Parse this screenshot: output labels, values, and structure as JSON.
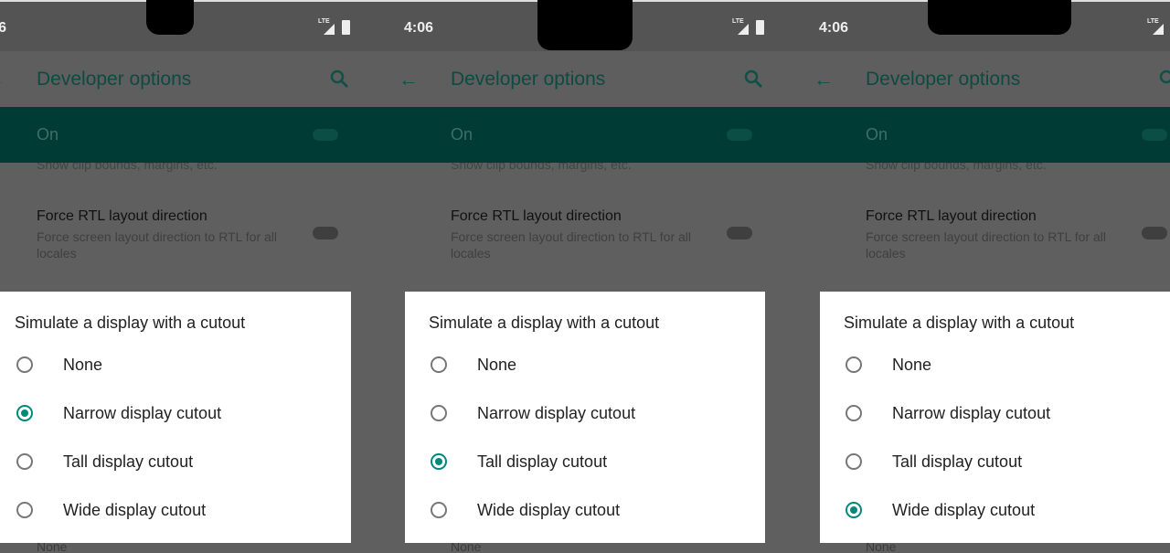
{
  "status_time": "4:06",
  "network_label": "LTE",
  "app_title": "Developer options",
  "master_switch_label": "On",
  "clip_bounds_subtitle": "Show clip bounds, margins, etc.",
  "rtl_title": "Force RTL layout direction",
  "rtl_subtitle": "Force screen layout direction to RTL for all locales",
  "below_dialog_value": "None",
  "dialog_title": "Simulate a display with a cutout",
  "options": [
    "None",
    "Narrow display cutout",
    "Tall display cutout",
    "Wide display cutout"
  ],
  "accent_color": "#00897b",
  "panels": [
    {
      "selected_option": "Narrow display cutout",
      "notch": "narrow"
    },
    {
      "selected_option": "Tall display cutout",
      "notch": "tall"
    },
    {
      "selected_option": "Wide display cutout",
      "notch": "wide"
    }
  ]
}
